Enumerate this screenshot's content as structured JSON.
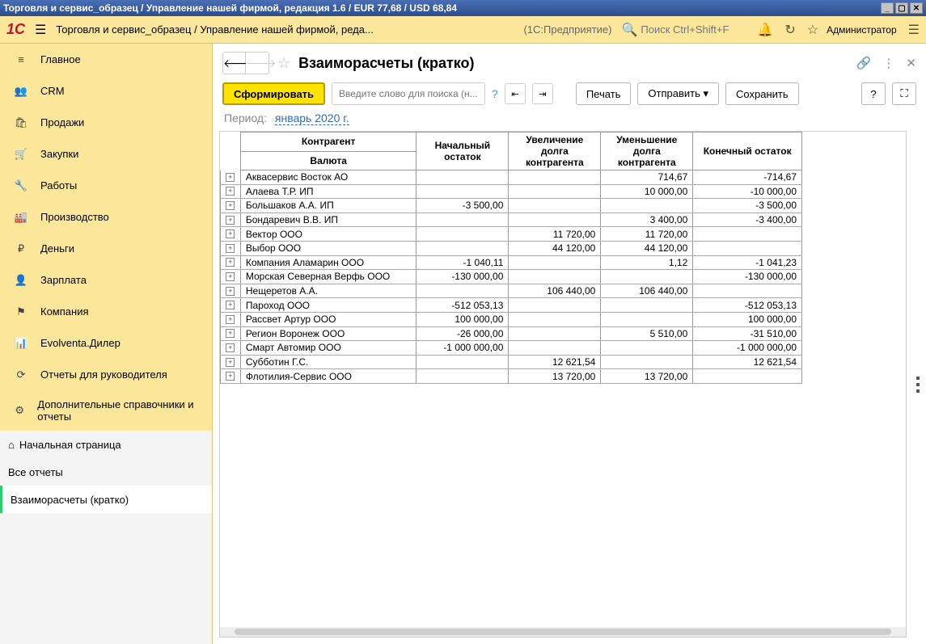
{
  "window": {
    "title": "Торговля и сервис_образец / Управление нашей фирмой, редакция 1.6 / EUR 77,68 / USD 68,84"
  },
  "toolbar": {
    "breadcrumb": "Торговля и сервис_образец / Управление нашей фирмой, реда...",
    "platform": "(1С:Предприятие)",
    "search_placeholder": "Поиск Ctrl+Shift+F",
    "admin_label": "Администратор"
  },
  "sidebar": {
    "items": [
      {
        "label": "Главное"
      },
      {
        "label": "CRM"
      },
      {
        "label": "Продажи"
      },
      {
        "label": "Закупки"
      },
      {
        "label": "Работы"
      },
      {
        "label": "Производство"
      },
      {
        "label": "Деньги"
      },
      {
        "label": "Зарплата"
      },
      {
        "label": "Компания"
      },
      {
        "label": "Evolventa.Дилер"
      },
      {
        "label": "Отчеты для руководителя"
      },
      {
        "label": "Дополнительные справочники и отчеты"
      }
    ],
    "lower": [
      {
        "label": "Начальная страница"
      },
      {
        "label": "Все отчеты"
      },
      {
        "label": "Взаиморасчеты (кратко)"
      }
    ]
  },
  "page": {
    "title": "Взаиморасчеты (кратко)",
    "generate": "Сформировать",
    "search_placeholder": "Введите слово для поиска (н...",
    "print": "Печать",
    "send": "Отправить",
    "save": "Сохранить",
    "period_label": "Период:",
    "period_value": "январь 2020 г."
  },
  "report": {
    "headers": {
      "agent": "Контрагент",
      "currency": "Валюта",
      "opening": "Начальный остаток",
      "increase": "Увеличение долга контрагента",
      "decrease": "Уменьшение долга контрагента",
      "closing": "Конечный остаток"
    },
    "rows": [
      {
        "name": "Аквасервис Восток АО",
        "open": "",
        "inc": "",
        "dec": "714,67",
        "close": "-714,67"
      },
      {
        "name": "Алаева Т.Р. ИП",
        "open": "",
        "inc": "",
        "dec": "10 000,00",
        "close": "-10 000,00"
      },
      {
        "name": "Большаков А.А. ИП",
        "open": "-3 500,00",
        "inc": "",
        "dec": "",
        "close": "-3 500,00"
      },
      {
        "name": "Бондаревич В.В. ИП",
        "open": "",
        "inc": "",
        "dec": "3 400,00",
        "close": "-3 400,00"
      },
      {
        "name": "Вектор ООО",
        "open": "",
        "inc": "11 720,00",
        "dec": "11 720,00",
        "close": ""
      },
      {
        "name": "Выбор ООО",
        "open": "",
        "inc": "44 120,00",
        "dec": "44 120,00",
        "close": ""
      },
      {
        "name": "Компания Аламарин ООО",
        "open": "-1 040,11",
        "inc": "",
        "dec": "1,12",
        "close": "-1 041,23"
      },
      {
        "name": "Морская Северная Верфь ООО",
        "open": "-130 000,00",
        "inc": "",
        "dec": "",
        "close": "-130 000,00"
      },
      {
        "name": "Нещеретов А.А.",
        "open": "",
        "inc": "106 440,00",
        "dec": "106 440,00",
        "close": ""
      },
      {
        "name": "Пароход ООО",
        "open": "-512 053,13",
        "inc": "",
        "dec": "",
        "close": "-512 053,13"
      },
      {
        "name": "Рассвет Артур ООО",
        "open": "100 000,00",
        "inc": "",
        "dec": "",
        "close": "100 000,00"
      },
      {
        "name": "Регион Воронеж ООО",
        "open": "-26 000,00",
        "inc": "",
        "dec": "5 510,00",
        "close": "-31 510,00"
      },
      {
        "name": "Смарт Автомир ООО",
        "open": "-1 000 000,00",
        "inc": "",
        "dec": "",
        "close": "-1 000 000,00"
      },
      {
        "name": "Субботин Г.С.",
        "open": "",
        "inc": "12 621,54",
        "dec": "",
        "close": "12 621,54"
      },
      {
        "name": "Флотилия-Сервис ООО",
        "open": "",
        "inc": "13 720,00",
        "dec": "13 720,00",
        "close": ""
      }
    ]
  }
}
